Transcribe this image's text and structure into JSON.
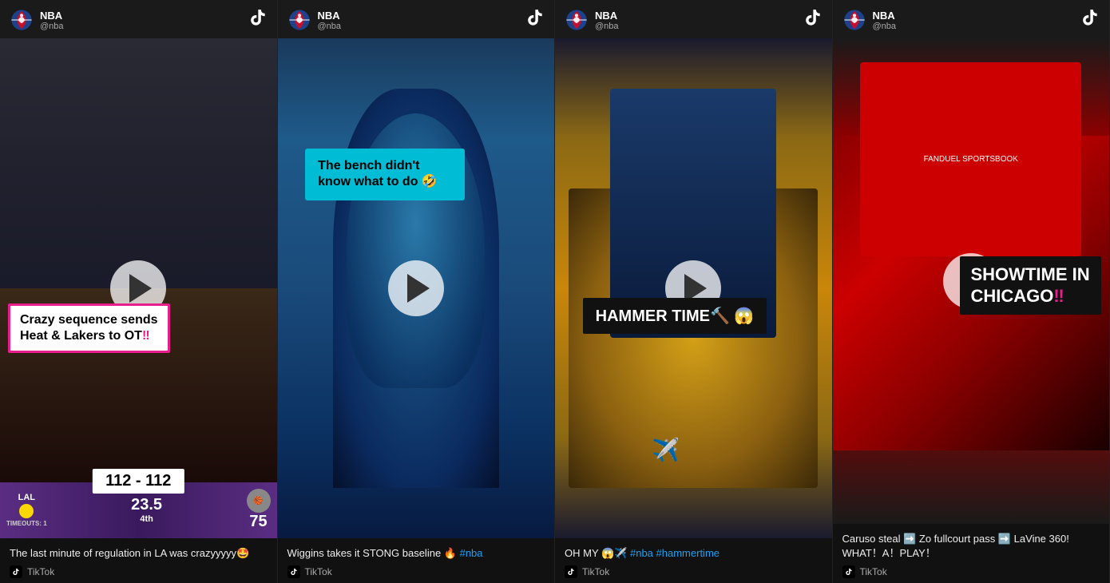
{
  "cards": [
    {
      "id": "card1",
      "account": {
        "name": "NBA",
        "handle": "@nba"
      },
      "overlay": {
        "title_line1": "Crazy sequence sends",
        "title_line2": "Heat & Lakers to OT",
        "exclamation": "‼",
        "score": "112 - 112"
      },
      "scoreboard": {
        "team": "LAL",
        "time": "23.5",
        "quarter": "4th",
        "timeouts": "TIMEOUTS: 1",
        "score": "75"
      },
      "description": "The last minute of regulation in LA was crazyyyyy🤩",
      "source": "TikTok"
    },
    {
      "id": "card2",
      "account": {
        "name": "NBA",
        "handle": "@nba"
      },
      "overlay": {
        "text": "The bench didn't know what to do 🤣"
      },
      "description": "Wiggins takes it STONG baseline 🔥 #nba",
      "source": "TikTok"
    },
    {
      "id": "card3",
      "account": {
        "name": "NBA",
        "handle": "@nba"
      },
      "overlay": {
        "text": "HAMMER TIME🔨 😱"
      },
      "description": "OH MY 😱✈️ #nba #hammertime",
      "source": "TikTok"
    },
    {
      "id": "card4",
      "account": {
        "name": "NBA",
        "handle": "@nba"
      },
      "overlay": {
        "line1": "SHOWTIME IN",
        "line2": "CHICAGO",
        "exclamation": "‼"
      },
      "description": "Caruso steal ➡️ Zo fullcourt pass ➡️ LaVine 360! WHAT！A！PLAY！",
      "source": "TikTok"
    }
  ],
  "tiktok_label": "TikTok",
  "play_button_label": "Play"
}
